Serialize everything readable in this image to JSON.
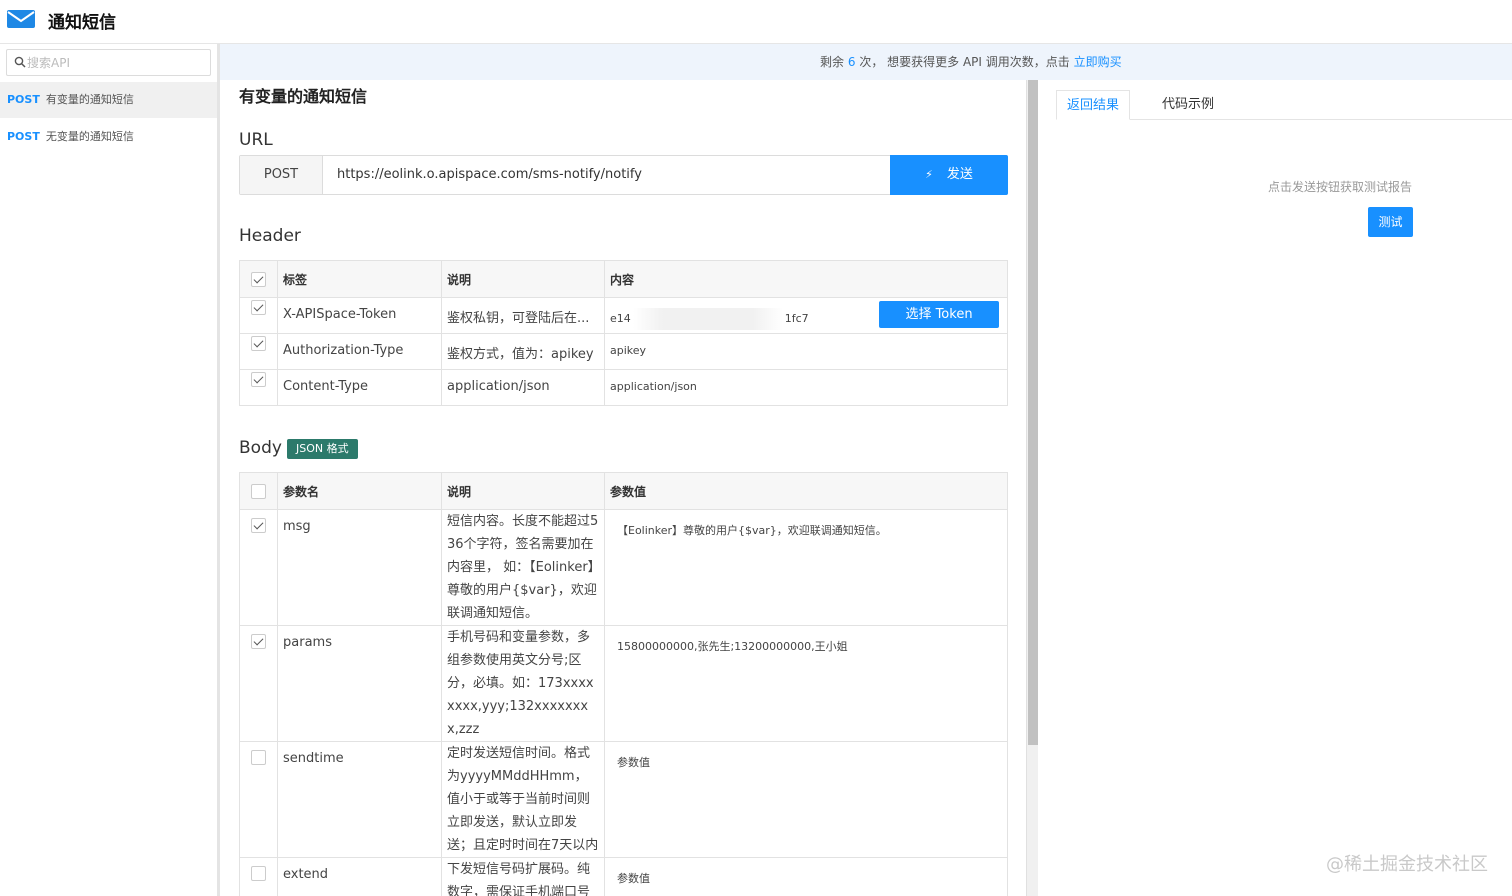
{
  "app": {
    "title": "通知短信"
  },
  "sidebar": {
    "search_placeholder": "搜索API",
    "items": [
      {
        "method": "POST",
        "label": "有变量的通知短信",
        "active": true
      },
      {
        "method": "POST",
        "label": "无变量的通知短信",
        "active": false
      }
    ]
  },
  "notice": {
    "prefix": "剩余",
    "count": "6",
    "middle": "次， 想要获得更多 API 调用次数，点击",
    "link": "立即购买"
  },
  "main": {
    "title": "有变量的通知短信",
    "url_section": "URL",
    "method": "POST",
    "url": "https://eolink.o.apispace.com/sms-notify/notify",
    "send_label": "发送",
    "header_section": "Header",
    "header_columns": [
      "标签",
      "说明",
      "内容"
    ],
    "headers": [
      {
        "checked": true,
        "name": "X-APISpace-Token",
        "desc": "鉴权私钥，可登陆后在...",
        "value_start": "e14",
        "value_end": "1fc7",
        "button": "选择 Token"
      },
      {
        "checked": true,
        "name": "Authorization-Type",
        "desc": "鉴权方式，值为：apikey",
        "value": "apikey"
      },
      {
        "checked": true,
        "name": "Content-Type",
        "desc": "application/json",
        "value": "application/json"
      }
    ],
    "body_section": "Body",
    "body_badge": "JSON 格式",
    "body_columns": [
      "参数名",
      "说明",
      "参数值"
    ],
    "params": [
      {
        "checked": true,
        "name": "msg",
        "desc": "短信内容。长度不能超过536个字符，签名需要加在内容里， 如：【Eolinker】尊敬的用户{$var}，欢迎联调通知短信。",
        "value": "【Eolinker】尊敬的用户{$var}，欢迎联调通知短信。"
      },
      {
        "checked": true,
        "name": "params",
        "desc": "手机号码和变量参数，多组参数使用英文分号;区分，必填。如：173xxxxxxxx,yyy;132xxxxxxxx,zzz",
        "value": "15800000000,张先生;13200000000,王小姐"
      },
      {
        "checked": false,
        "name": "sendtime",
        "desc": "定时发送短信时间。格式为yyyyMMddHHmm，值小于或等于当前时间则立即发送，默认立即发送；且定时时间在7天以内",
        "placeholder": "参数值"
      },
      {
        "checked": false,
        "name": "extend",
        "desc": "下发短信号码扩展码。纯数字，需保证手机端口号加自定义扩展码总位数不",
        "placeholder": "参数值"
      }
    ]
  },
  "right": {
    "tabs": [
      "返回结果",
      "代码示例"
    ],
    "hint": "点击发送按钮获取测试报告",
    "test_label": "测试"
  },
  "watermark": "@稀土掘金技术社区",
  "colors": {
    "accent": "#1890ff",
    "badge": "#2c7a6b",
    "notice_bg": "#eef4fc"
  }
}
